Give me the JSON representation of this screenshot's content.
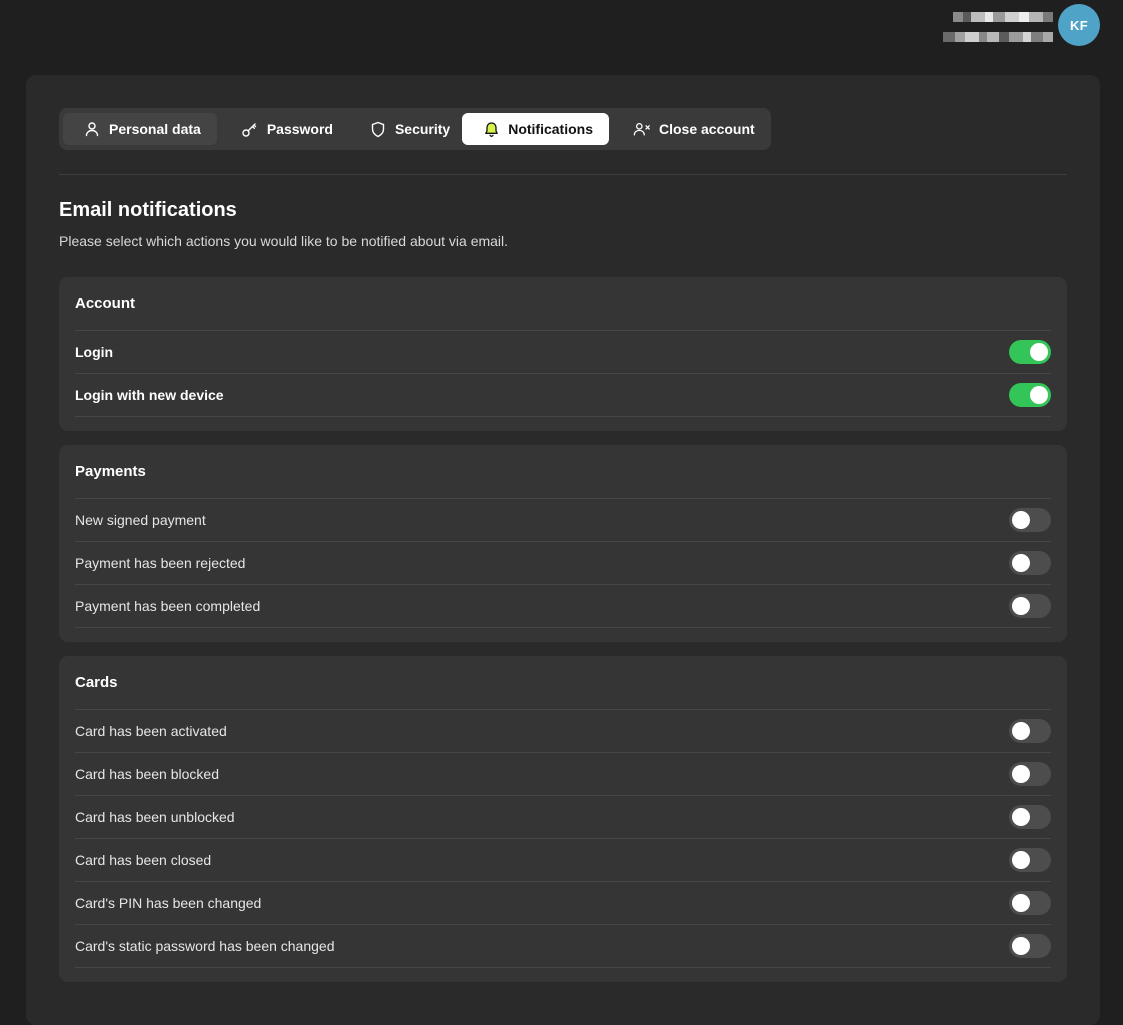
{
  "user": {
    "initials": "KF"
  },
  "tabs": [
    {
      "label": "Personal data",
      "icon": "user-icon"
    },
    {
      "label": "Password",
      "icon": "key-icon"
    },
    {
      "label": "Security",
      "icon": "shield-icon"
    },
    {
      "label": "Notifications",
      "icon": "bell-icon",
      "active": true
    },
    {
      "label": "Close account",
      "icon": "user-x-icon"
    }
  ],
  "page": {
    "title": "Email notifications",
    "subtitle": "Please select which actions you would like to be notified about via email."
  },
  "sections": {
    "account": {
      "title": "Account",
      "items": [
        {
          "label": "Login",
          "enabled": true
        },
        {
          "label": "Login with new device",
          "enabled": true
        }
      ]
    },
    "payments": {
      "title": "Payments",
      "items": [
        {
          "label": "New signed payment",
          "enabled": false
        },
        {
          "label": "Payment has been rejected",
          "enabled": false
        },
        {
          "label": "Payment has been completed",
          "enabled": false
        }
      ]
    },
    "cards": {
      "title": "Cards",
      "items": [
        {
          "label": "Card has been activated",
          "enabled": false
        },
        {
          "label": "Card has been blocked",
          "enabled": false
        },
        {
          "label": "Card has been unblocked",
          "enabled": false
        },
        {
          "label": "Card has been closed",
          "enabled": false
        },
        {
          "label": "Card's PIN has been changed",
          "enabled": false
        },
        {
          "label": "Card's static password has been changed",
          "enabled": false
        }
      ]
    }
  },
  "colors": {
    "background": "#1f1f1f",
    "panel": "#2a2a2a",
    "section": "#353535",
    "toggle_on": "#34c559",
    "toggle_off": "#4d4d4d",
    "avatar": "#4fa3c7"
  }
}
